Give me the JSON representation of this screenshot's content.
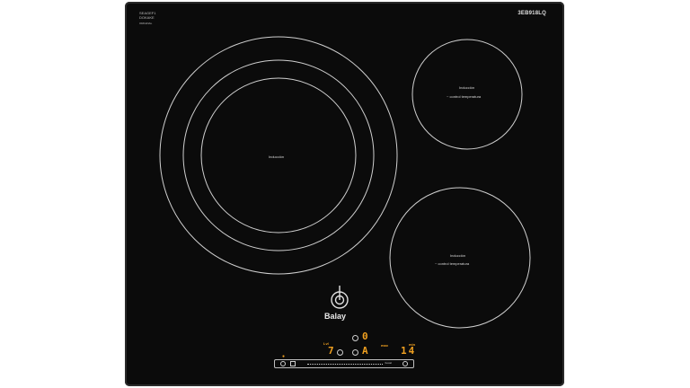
{
  "hob": {
    "model": "3EB918LQ",
    "certification": [
      "SEAGEF1",
      "DOKAKE",
      "ORIGINAL"
    ],
    "brand": "Balay",
    "zones": [
      {
        "label": "Inducción",
        "sublabel": ""
      },
      {
        "label": "Inducción",
        "sublabel": "control temperatura"
      },
      {
        "label": "Inducción",
        "sublabel": "control temperatura"
      }
    ],
    "controls": {
      "display_top": "0",
      "display_left": "7",
      "display_mid": "A",
      "display_right": "14",
      "label_left": "Lvl",
      "label_mid": "max",
      "label_right": "min",
      "boost_label": "boost"
    },
    "colors": {
      "glass": "#0b0b0b",
      "ring": "#cfcfcf",
      "display": "#f0a020"
    }
  }
}
